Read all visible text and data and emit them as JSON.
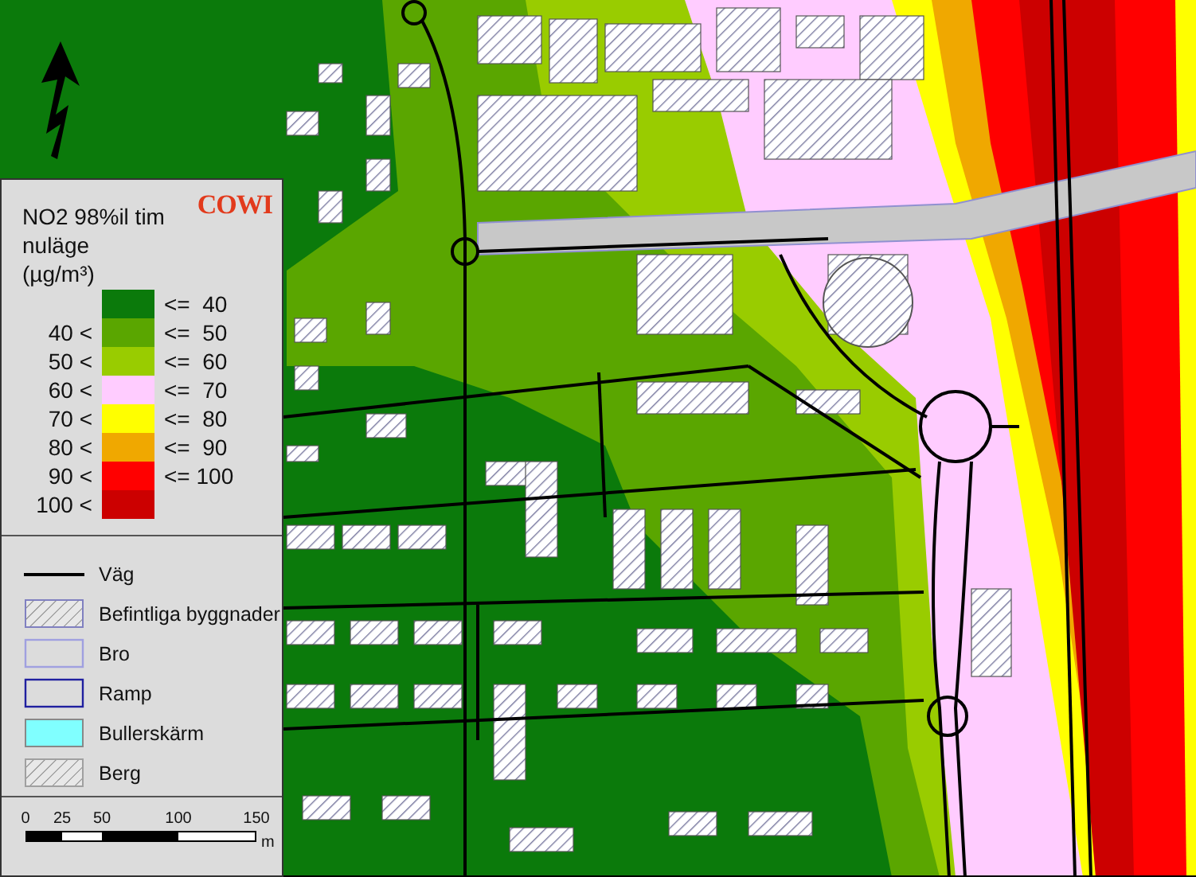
{
  "legend": {
    "logo": "COWI",
    "title": "NO2 98%il tim\nnuläge\n(µg/m³)",
    "classes": [
      {
        "upper": "<=  40",
        "color": "#0b7a0b"
      },
      {
        "lower": "40 <",
        "upper": "<=  50",
        "color": "#5aa600"
      },
      {
        "lower": "50 <",
        "upper": "<=  60",
        "color": "#99cc00"
      },
      {
        "lower": "60 <",
        "upper": "<=  70",
        "color": "#ffccff"
      },
      {
        "lower": "70 <",
        "upper": "<=  80",
        "color": "#ffff00"
      },
      {
        "lower": "80 <",
        "upper": "<=  90",
        "color": "#f0a800"
      },
      {
        "lower": "90 <",
        "upper": "<= 100",
        "color": "#ff0000"
      },
      {
        "lower": "100 <",
        "color": "#cc0000"
      }
    ],
    "symbols": [
      {
        "kind": "line",
        "label": "Väg",
        "color": "#000000"
      },
      {
        "kind": "hatch",
        "label": "Befintliga byggnader",
        "color": "#8080c0"
      },
      {
        "kind": "outline",
        "label": "Bro",
        "color": "#a0a0e0"
      },
      {
        "kind": "outline",
        "label": "Ramp",
        "color": "#2020a0"
      },
      {
        "kind": "fill",
        "label": "Bullerskärm",
        "color": "#80ffff"
      },
      {
        "kind": "hatch",
        "label": "Berg",
        "color": "#a0a0a0"
      }
    ],
    "scale": {
      "ticks": [
        "0",
        "25",
        "50",
        "100",
        "150"
      ],
      "unit": "m"
    }
  }
}
